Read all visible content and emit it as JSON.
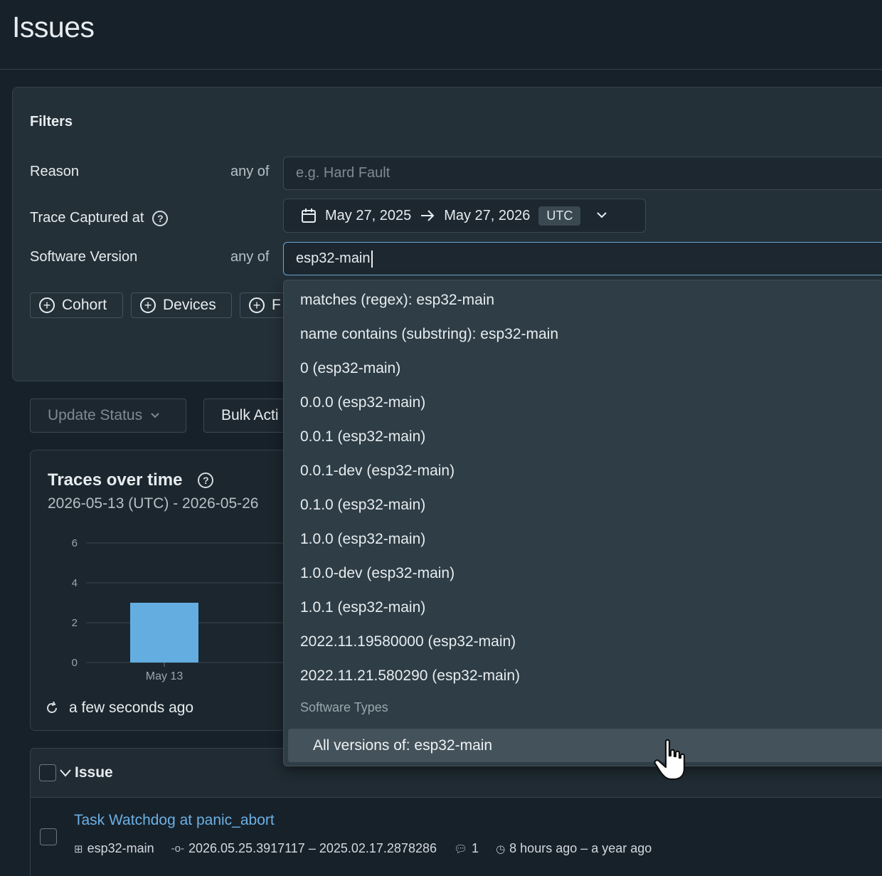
{
  "header": {
    "title": "Issues"
  },
  "filters": {
    "title": "Filters",
    "reason": {
      "label": "Reason",
      "op": "any of",
      "placeholder": "e.g. Hard Fault"
    },
    "trace_captured": {
      "label": "Trace Captured at",
      "from": "May 27, 2025",
      "to": "May 27, 2026",
      "tz": "UTC"
    },
    "software_version": {
      "label": "Software Version",
      "op": "any of",
      "value": "esp32-main"
    },
    "add_buttons": [
      "Cohort",
      "Devices",
      "F"
    ]
  },
  "toolbar": {
    "update_status": "Update Status",
    "bulk_actions": "Bulk Acti"
  },
  "chart": {
    "title": "Traces over time",
    "subtitle": "2026-05-13 (UTC) - 2026-05-26",
    "refresh_text": "a few seconds ago"
  },
  "chart_data": {
    "type": "bar",
    "categories": [
      "May 13"
    ],
    "values": [
      3
    ],
    "y_ticks": [
      "0",
      "2",
      "4",
      "6"
    ],
    "ylim": [
      0,
      6
    ],
    "bar_color": "#63ade0"
  },
  "table": {
    "header": "Issue",
    "rows": [
      {
        "title": "Task Watchdog at panic_abort",
        "software_type": "esp32-main",
        "versions": "2026.05.25.3917117 – 2025.02.17.2878286",
        "comments": "1",
        "time": "8 hours ago – a year ago"
      }
    ]
  },
  "dropdown": {
    "items": [
      "matches (regex): esp32-main",
      "name contains (substring): esp32-main",
      "0 (esp32-main)",
      "0.0.0 (esp32-main)",
      "0.0.1 (esp32-main)",
      "0.0.1-dev (esp32-main)",
      "0.1.0 (esp32-main)",
      "1.0.0 (esp32-main)",
      "1.0.0-dev (esp32-main)",
      "1.0.1 (esp32-main)",
      "2022.11.19580000 (esp32-main)",
      "2022.11.21.580290 (esp32-main)"
    ],
    "group_label": "Software Types",
    "active_item": "All versions of: esp32-main"
  },
  "icons": {
    "help": "help-circle-icon",
    "calendar": "calendar-icon",
    "arrow": "arrow-right-icon",
    "chevron": "chevron-down-icon",
    "plus": "plus-circle-icon",
    "refresh": "refresh-icon",
    "pointer": "hand-pointer-icon"
  }
}
